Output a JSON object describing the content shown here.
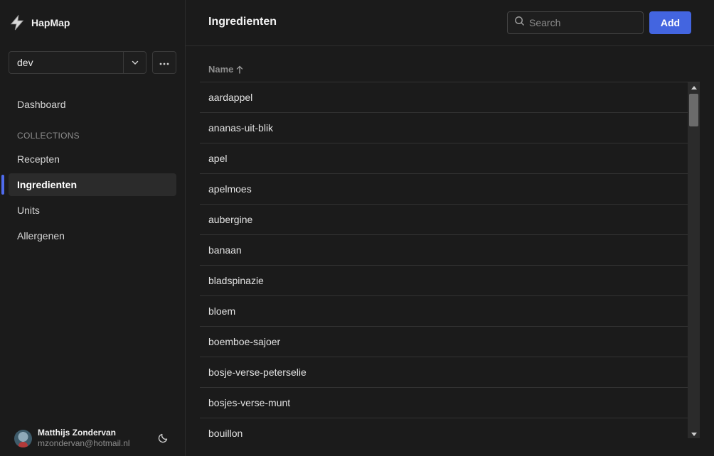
{
  "app": {
    "name": "HapMap"
  },
  "environment": {
    "selected": "dev"
  },
  "nav": {
    "dashboard": "Dashboard",
    "section_label": "COLLECTIONS",
    "items": [
      {
        "label": "Recepten",
        "active": false
      },
      {
        "label": "Ingredienten",
        "active": true
      },
      {
        "label": "Units",
        "active": false
      },
      {
        "label": "Allergenen",
        "active": false
      }
    ]
  },
  "user": {
    "name": "Matthijs Zondervan",
    "email": "mzondervan@hotmail.nl"
  },
  "header": {
    "title": "Ingredienten",
    "search_placeholder": "Search",
    "add_label": "Add"
  },
  "table": {
    "column": "Name",
    "sort": "ascending",
    "rows": [
      "aardappel",
      "ananas-uit-blik",
      "apel",
      "apelmoes",
      "aubergine",
      "banaan",
      "bladspinazie",
      "bloem",
      "boemboe-sajoer",
      "bosje-verse-peterselie",
      "bosjes-verse-munt",
      "bouillon"
    ]
  },
  "colors": {
    "accent": "#4365e0",
    "background": "#1b1b1b"
  },
  "icons": {
    "logo": "bolt-logo-icon",
    "chevron": "chevron-down-icon",
    "more": "more-horizontal-icon",
    "search": "search-icon",
    "sort": "arrow-up-icon",
    "theme": "moon-icon"
  }
}
